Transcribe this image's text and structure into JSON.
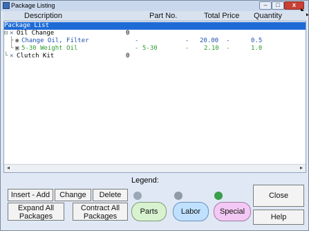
{
  "window": {
    "title": "Package Listing",
    "controls": {
      "min": "–",
      "max": "□",
      "close": "x"
    }
  },
  "table": {
    "columns": [
      "Description",
      "Part No.",
      "Total Price",
      "Quantity"
    ],
    "rows": [
      {
        "label": "Package List",
        "selected": true,
        "indent": 0,
        "icon": "package-icon"
      },
      {
        "label": "Oil Change",
        "indent": 1,
        "icon": "tools-icon",
        "code": "0"
      },
      {
        "label": "Change Oil, Filter",
        "indent": 2,
        "icon": "labor-icon",
        "part": "-",
        "price": "20.00",
        "qty": "0.5",
        "sep1": "-",
        "sep2": "-",
        "color": "blue"
      },
      {
        "label": "5-30 Weight Oil",
        "indent": 2,
        "icon": "part-icon",
        "part": "5-30",
        "price": "2.10",
        "qty": "1.0",
        "sep1": "-",
        "sep2": "-",
        "sep0": "-",
        "color": "green"
      },
      {
        "label": "Clutch Kit",
        "indent": 1,
        "icon": "tools-icon",
        "code": "0"
      }
    ]
  },
  "legend": {
    "title": "Legend:"
  },
  "buttons": {
    "insert": "Insert - Add",
    "change": "Change",
    "delete": "Delete",
    "expand_line1": "Expand All",
    "expand_line2": "Packages",
    "contract_line1": "Contract All",
    "contract_line2": "Packages",
    "close": "Close",
    "help": "Help"
  },
  "pills": {
    "parts": "Parts",
    "labor": "Labor",
    "special": "Special"
  }
}
